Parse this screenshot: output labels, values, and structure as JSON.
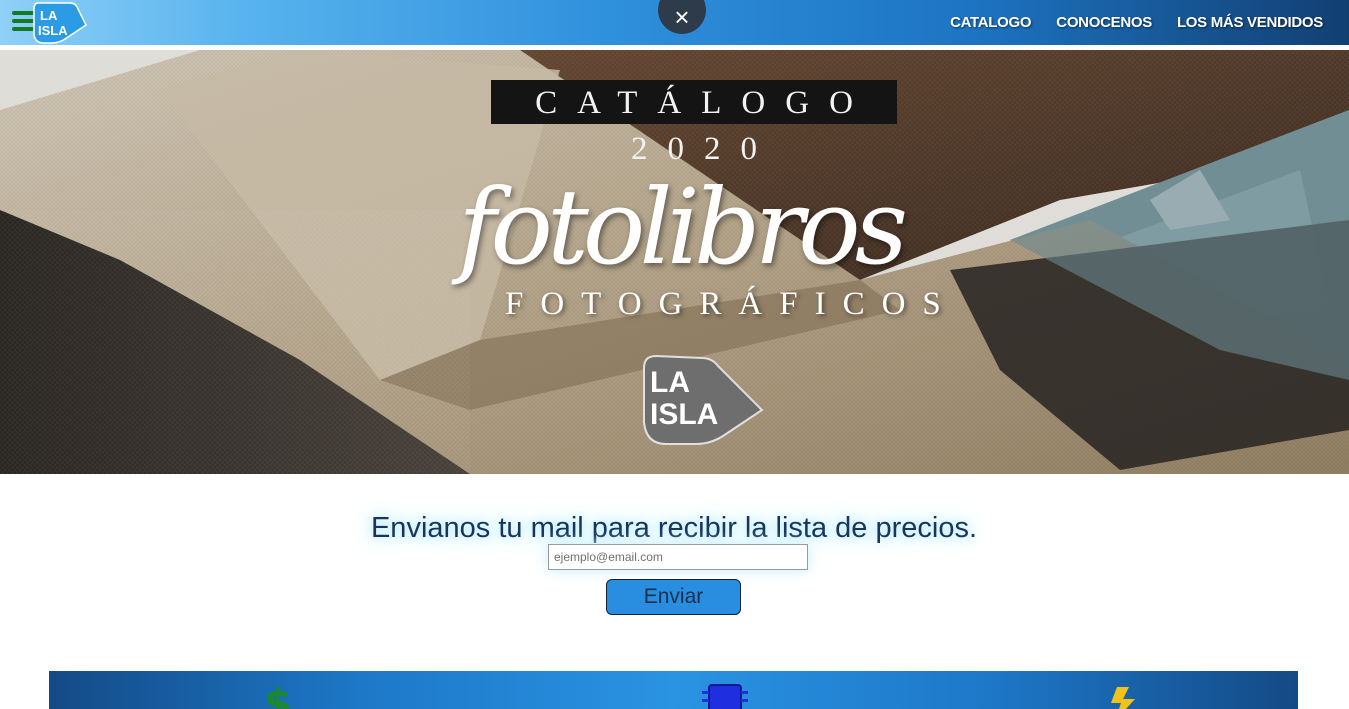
{
  "header": {
    "menu_icon": "hamburger-icon",
    "logo_text_line1": "LA",
    "logo_text_line2": "ISLA",
    "close_symbol": "×",
    "nav": [
      {
        "label": "CATALOGO"
      },
      {
        "label": "CONOCENOS"
      },
      {
        "label": "LOS MÁS VENDIDOS"
      }
    ]
  },
  "hero": {
    "badge": "CATÁLOGO 2020",
    "script_title": "fotolibros",
    "subtitle": "FOTOGRÁFICOS",
    "logo_line1": "LA",
    "logo_line2": "ISLA"
  },
  "signup": {
    "title": "Envianos tu mail para recibir la lista de precios.",
    "placeholder": "ejemplo@email.com",
    "button_label": "Enviar"
  },
  "features": {
    "icons": [
      "dollar-icon",
      "chip-icon",
      "lightning-icon"
    ]
  },
  "colors": {
    "nav_dark": "#123f72",
    "nav_light": "#8fd0f7",
    "menu_green": "#167a25",
    "button_blue": "#2a8ee0",
    "title_navy": "#16365d"
  }
}
